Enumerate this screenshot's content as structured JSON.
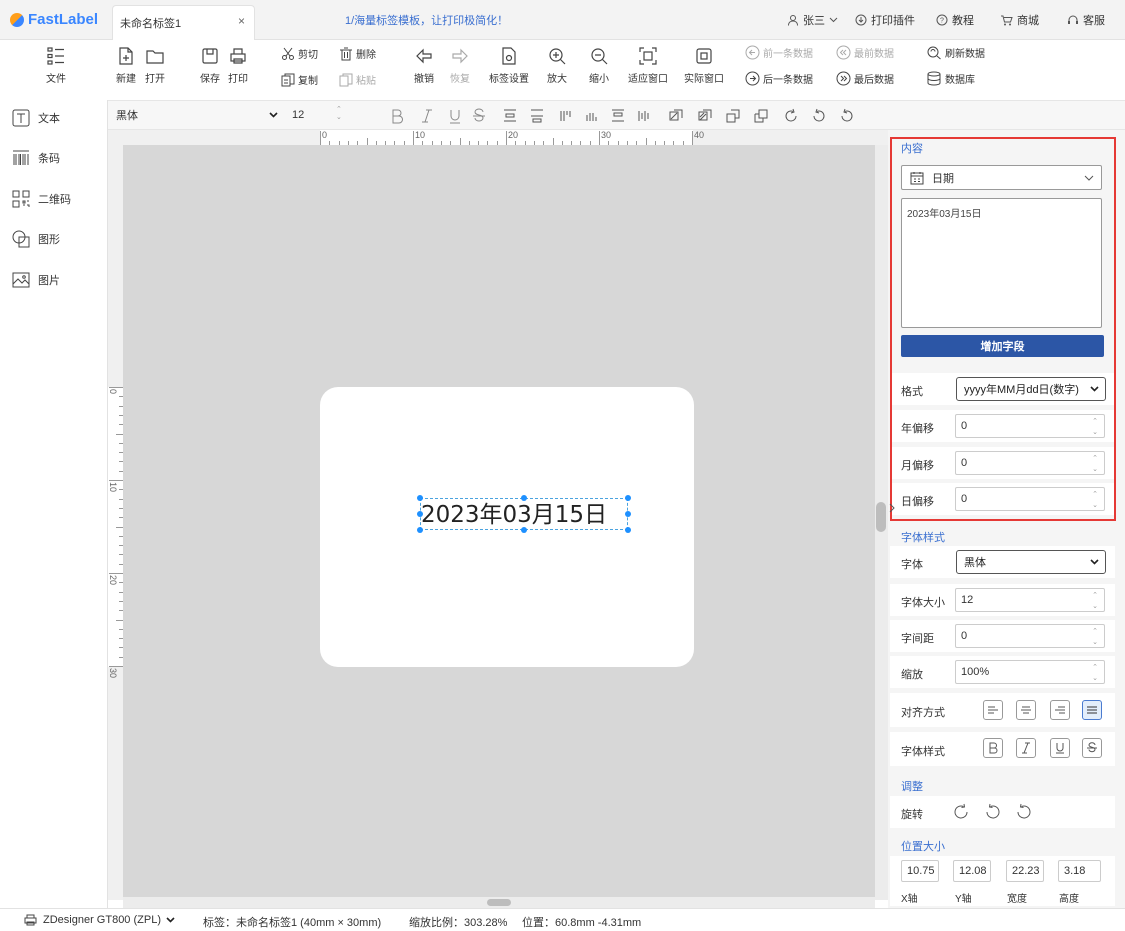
{
  "app": {
    "name": "FastLabel",
    "tab_title": "未命名标签1",
    "tab_close": "×",
    "notice": "1/海量标签模板，让打印极简化！"
  },
  "top_menu": {
    "user": "张三",
    "plugin": "打印插件",
    "tutorial": "教程",
    "store": "商城",
    "service": "客服"
  },
  "toolbar": {
    "file": "文件",
    "new": "新建",
    "open": "打开",
    "save": "保存",
    "print": "打印",
    "cut": "剪切",
    "delete": "删除",
    "copy": "复制",
    "paste": "粘贴",
    "undo": "撤销",
    "redo": "恢复",
    "label_settings": "标签设置",
    "zoom_in": "放大",
    "zoom_out": "缩小",
    "fit_window": "适应窗口",
    "actual_window": "实际窗口",
    "prev_record": "前一条数据",
    "first_record": "最前数据",
    "refresh_data": "刷新数据",
    "next_record": "后一条数据",
    "last_record": "最后数据",
    "database": "数据库"
  },
  "format_bar": {
    "font": "黑体",
    "size": "12"
  },
  "sidebar": {
    "items": [
      {
        "label": "文本",
        "icon": "text-icon"
      },
      {
        "label": "条码",
        "icon": "barcode-icon"
      },
      {
        "label": "二维码",
        "icon": "qrcode-icon"
      },
      {
        "label": "图形",
        "icon": "shape-icon"
      },
      {
        "label": "图片",
        "icon": "image-icon"
      }
    ]
  },
  "ruler": {
    "h_ticks": [
      "0",
      "10",
      "20",
      "30",
      "40"
    ],
    "v_ticks": [
      "0",
      "10",
      "20",
      "30"
    ]
  },
  "canvas": {
    "text": "2023年03月15日"
  },
  "panel": {
    "content_title": "内容",
    "content_type": "日期",
    "content_value": "2023年03月15日",
    "add_field": "增加字段",
    "format_label": "格式",
    "format_value": "yyyy年MM月dd日(数字)",
    "year_offset_label": "年偏移",
    "year_offset": "0",
    "month_offset_label": "月偏移",
    "month_offset": "0",
    "day_offset_label": "日偏移",
    "day_offset": "0",
    "font_style_title": "字体样式",
    "font_label": "字体",
    "font_value": "黑体",
    "font_size_label": "字体大小",
    "font_size": "12",
    "spacing_label": "字间距",
    "spacing": "0",
    "scale_label": "缩放",
    "scale": "100%",
    "align_label": "对齐方式",
    "style_label": "字体样式",
    "adjust_title": "调整",
    "rotate_label": "旋转",
    "pos_title": "位置大小",
    "x": "10.75",
    "y": "12.08",
    "w": "22.23",
    "h": "3.18",
    "x_label": "X轴",
    "y_label": "Y轴",
    "w_label": "宽度",
    "h_label": "高度"
  },
  "status": {
    "printer": "ZDesigner GT800 (ZPL)",
    "label": "标签：未命名标签1 (40mm × 30mm)",
    "zoom": "缩放比例：303.28%",
    "position": "位置：60.8mm -4.31mm"
  },
  "colors": {
    "accent": "#2c56a6",
    "highlight": "#e53935",
    "selection": "#1e90ff"
  }
}
